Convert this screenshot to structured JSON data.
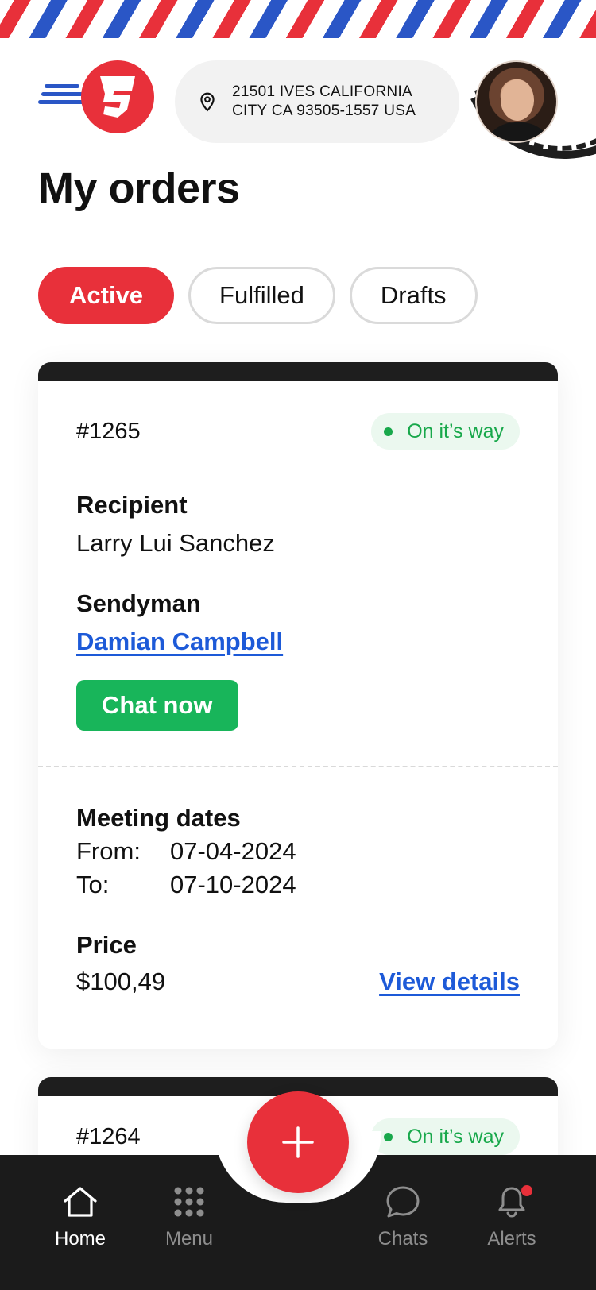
{
  "header": {
    "address_line1": "21501 IVES CALIFORNIA",
    "address_line2": "CITY CA 93505-1557 USA"
  },
  "page_title": "My orders",
  "tabs": [
    {
      "label": "Active",
      "active": true
    },
    {
      "label": "Fulfilled",
      "active": false
    },
    {
      "label": "Drafts",
      "active": false
    }
  ],
  "orders": [
    {
      "id": "#1265",
      "status": "On it’s way",
      "recipient_label": "Recipient",
      "recipient": "Larry Lui Sanchez",
      "sendyman_label": "Sendyman",
      "sendyman": "Damian Campbell",
      "chat_label": "Chat now",
      "meeting_label": "Meeting dates",
      "from_label": "From:",
      "from": "07-04-2024",
      "to_label": "To:",
      "to": "07-10-2024",
      "price_label": "Price",
      "price": "$100,49",
      "details_label": "View details"
    },
    {
      "id": "#1264",
      "status": "On it’s way"
    }
  ],
  "nav": {
    "home": "Home",
    "menu": "Menu",
    "chats": "Chats",
    "alerts": "Alerts"
  },
  "colors": {
    "brand_red": "#e8303a",
    "airmail_blue": "#2a56c6",
    "success_green": "#18b55a",
    "link_blue": "#1d5ad8",
    "nav_dark": "#1b1b1b"
  },
  "icons": {
    "logo": "brand-s-logo-icon",
    "location": "location-pin-icon",
    "home": "home-icon",
    "menu": "grid-dots-icon",
    "chats": "chat-bubble-icon",
    "alerts": "bell-icon",
    "fab": "plus-icon"
  }
}
